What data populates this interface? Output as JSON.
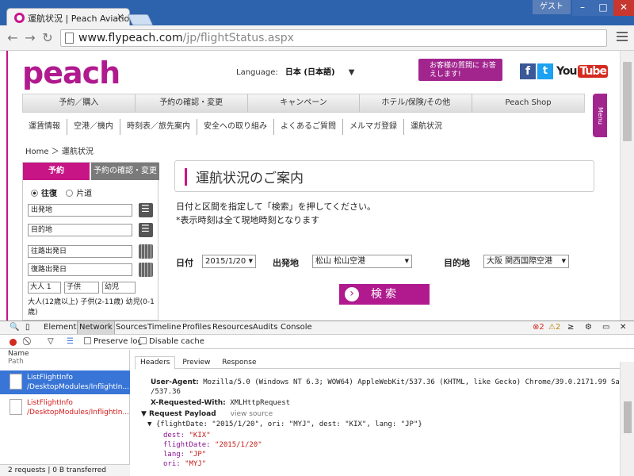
{
  "browser": {
    "tab_title": "運航状況 | Peach Aviatio",
    "guest_label": "ゲスト",
    "url_host": "www.flypeach.com",
    "url_path": "/jp/flightStatus.aspx"
  },
  "site": {
    "logo_text": "peach",
    "language_label": "Language:",
    "language_value": "日本 (日本語)",
    "help_banner": "お客様の質問に お答えします!",
    "social": {
      "facebook": "f",
      "twitter": "t",
      "youtube_you": "You",
      "youtube_tube": "Tube"
    },
    "main_nav": [
      "予約／購入",
      "予約の確認・変更",
      "キャンペーン",
      "ホテル/保険/その他",
      "Peach Shop"
    ],
    "sub_nav": [
      "運賃情報",
      "空港／機内",
      "時刻表／旅先案内",
      "安全への取り組み",
      "よくあるご質問",
      "メルマガ登録",
      "運航状況"
    ],
    "menu_tab": "Menu",
    "breadcrumb": "Home ＞ 運航状況"
  },
  "sidebar": {
    "tab_book": "予約",
    "tab_manage": "予約の確認・変更",
    "radio_roundtrip": "往復",
    "radio_oneway": "片道",
    "field_departure": "出発地",
    "field_destination": "目的地",
    "field_outbound_date": "往路出発日",
    "field_return_date": "復路出発日",
    "select_adult": "大人 1",
    "select_child": "子供",
    "select_infant": "幼児",
    "passenger_note": "大人(12歳以上) 子供(2-11歳) 幼児(0-1歳)"
  },
  "main": {
    "heading": "運航状況のご案内",
    "intro_line1": "日付と区間を指定して「検索」を押してください。",
    "intro_line2": "*表示時刻は全て現地時刻となります",
    "date_label": "日付",
    "date_value": "2015/1/20",
    "origin_label": "出発地",
    "origin_value": "松山 松山空港",
    "dest_label": "目的地",
    "dest_value": "大阪 関西国際空港",
    "search_button": "検索"
  },
  "devtools": {
    "tabs": [
      "Elements",
      "Network",
      "Sources",
      "Timeline",
      "Profiles",
      "Resources",
      "Audits",
      "Console"
    ],
    "errors": "2",
    "warnings": "2",
    "preserve_log": "Preserve log",
    "disable_cache": "Disable cache",
    "col_name": "Name",
    "col_path": "Path",
    "requests": [
      {
        "name": "ListFlightInfo",
        "path": "/DesktopModules/InflightIn..."
      },
      {
        "name": "ListFlightInfo",
        "path": "/DesktopModules/InflightIn..."
      }
    ],
    "footer": "2 requests | 0 B transferred",
    "detail_tabs": [
      "Headers",
      "Preview",
      "Response"
    ],
    "user_agent_key": "User-Agent:",
    "user_agent_val": "Mozilla/5.0 (Windows NT 6.3; WOW64) AppleWebKit/537.36 (KHTML, like Gecko) Chrome/39.0.2171.99 Safari",
    "user_agent_val2": "/537.36",
    "xrw_key": "X-Requested-With:",
    "xrw_val": "XMLHttpRequest",
    "payload_title": "▼ Request Payload",
    "view_source": "view source",
    "payload_summary": "▼ {flightDate: \"2015/1/20\", ori: \"MYJ\", dest: \"KIX\", lang: \"JP\"}",
    "payload": [
      {
        "k": "dest:",
        "v": "\"KIX\""
      },
      {
        "k": "flightDate:",
        "v": "\"2015/1/20\""
      },
      {
        "k": "lang:",
        "v": "\"JP\""
      },
      {
        "k": "ori:",
        "v": "\"MYJ\""
      }
    ]
  }
}
